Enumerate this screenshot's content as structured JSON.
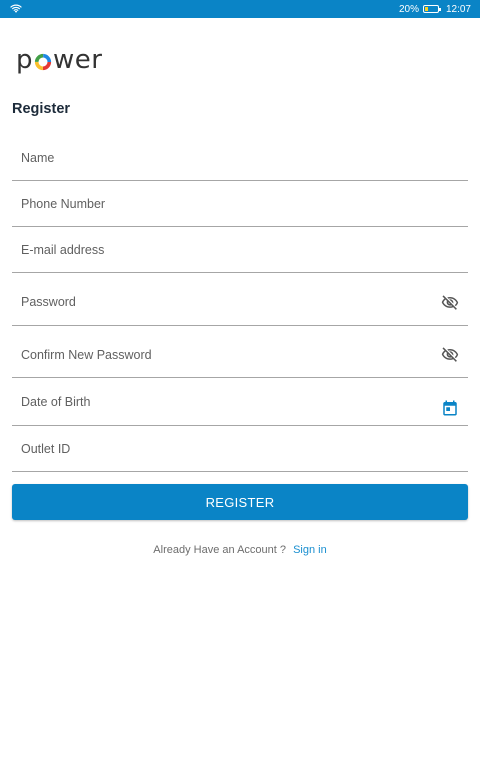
{
  "status_bar": {
    "battery_text": "20%",
    "battery_level": 0.2,
    "time": "12:07",
    "icons": [
      "wifi-icon",
      "battery-icon"
    ]
  },
  "logo": {
    "text_before": "p",
    "text_after": "wer",
    "ring_colors": [
      "#e53935",
      "#fbc02d",
      "#43a047",
      "#1e88e5"
    ]
  },
  "form": {
    "title": "Register",
    "fields": {
      "name": "Name",
      "phone": "Phone Number",
      "email": "E-mail address",
      "password": "Password",
      "confirm_password": "Confirm New Password",
      "dob": "Date of Birth",
      "outlet": "Outlet ID"
    },
    "register_label": "REGISTER"
  },
  "footer": {
    "prompt": "Already Have an Account ?",
    "signin_label": "Sign in"
  },
  "colors": {
    "primary": "#0a84c6",
    "link": "#1a8fd0",
    "icon": "#555555",
    "calendar_icon": "#0a84c6"
  }
}
